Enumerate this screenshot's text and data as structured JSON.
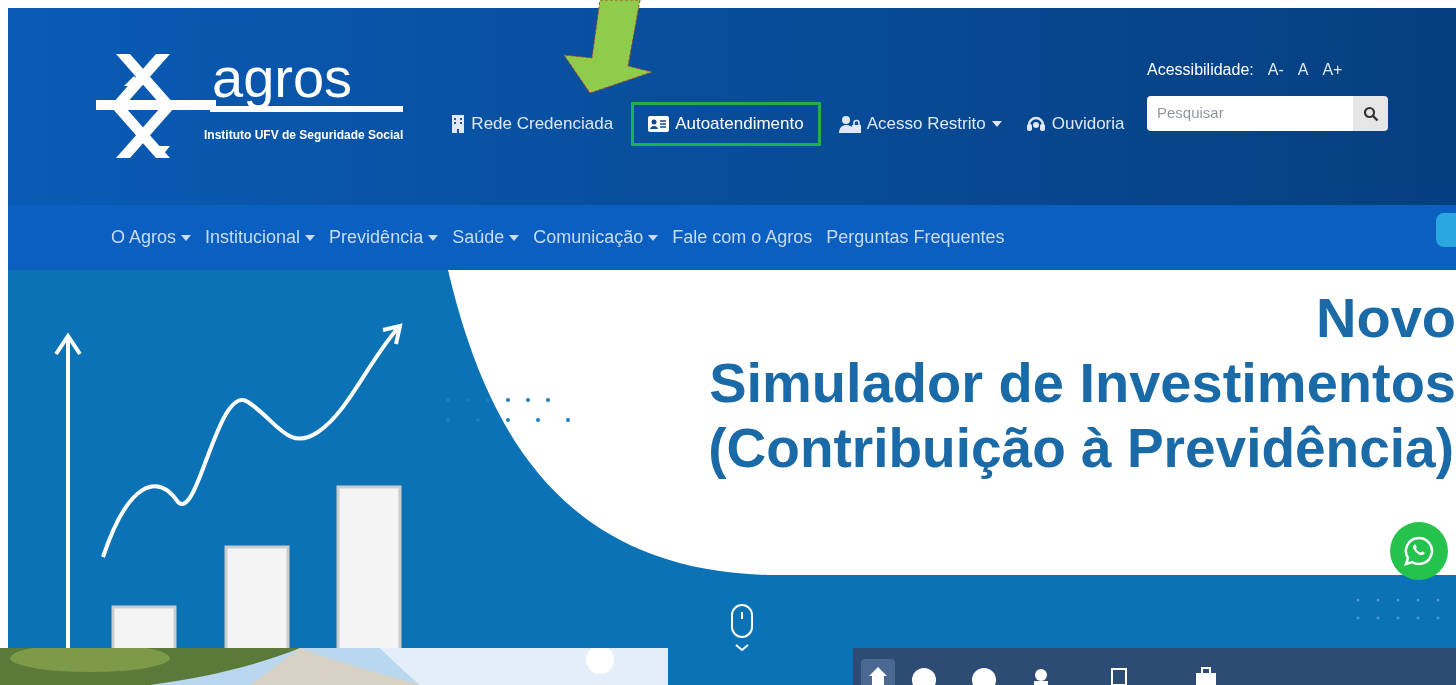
{
  "logo": {
    "name": "agros",
    "tagline": "Instituto UFV de Seguridade Social"
  },
  "top_links": [
    {
      "label": "Rede Credenciada",
      "kind": "building",
      "dropdown": false,
      "highlighted": false
    },
    {
      "label": "Autoatendimento",
      "kind": "card",
      "dropdown": false,
      "highlighted": true
    },
    {
      "label": "Acesso Restrito",
      "kind": "lock",
      "dropdown": true,
      "highlighted": false
    },
    {
      "label": "Ouvidoria",
      "kind": "headset",
      "dropdown": false,
      "highlighted": false
    }
  ],
  "accessibility": {
    "label": "Acessibilidade:",
    "options": [
      "A-",
      "A",
      "A+"
    ]
  },
  "search": {
    "placeholder": "Pesquisar"
  },
  "main_nav": [
    {
      "label": "O Agros",
      "dropdown": true
    },
    {
      "label": "Institucional",
      "dropdown": true
    },
    {
      "label": "Previdência",
      "dropdown": true
    },
    {
      "label": "Saúde",
      "dropdown": true
    },
    {
      "label": "Comunicação",
      "dropdown": true
    },
    {
      "label": "Fale com o Agros",
      "dropdown": false
    },
    {
      "label": "Perguntas Frequentes",
      "dropdown": false
    }
  ],
  "banner": {
    "headline": "Novo",
    "title": "Simulador de Investimentos",
    "subtitle": "(Contribuição à Previdência)"
  }
}
